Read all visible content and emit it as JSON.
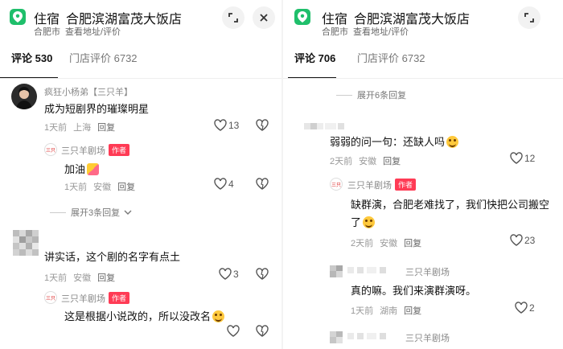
{
  "hotel": {
    "category": "住宿",
    "name": "合肥滨湖富茂大饭店",
    "city": "合肥市",
    "link": "查看地址/评价"
  },
  "left": {
    "tabs": {
      "comments": "评论 530",
      "store_reviews": "门店评价 6732"
    },
    "comments": [
      {
        "user": "疯狂小杨弟【三只羊】",
        "text": "成为短剧界的璀璨明星",
        "time": "1天前",
        "location": "上海",
        "reply": "回复",
        "likes": "13"
      },
      {
        "user": "三只羊剧场",
        "badge": "作者",
        "text": "加油",
        "time": "1天前",
        "location": "安徽",
        "reply": "回复",
        "likes": "4"
      },
      {
        "expand": "展开3条回复"
      },
      {
        "user": "",
        "text": "讲实话，这个剧的名字有点土",
        "time": "1天前",
        "location": "安徽",
        "reply": "回复",
        "likes": "3"
      },
      {
        "user": "三只羊剧场",
        "badge": "作者",
        "text": "这是根据小说改的，所以没改名"
      }
    ]
  },
  "right": {
    "tabs": {
      "comments": "评论 706",
      "store_reviews": "门店评价 6732"
    },
    "comments": [
      {
        "expand": "展开6条回复"
      },
      {
        "user": "",
        "text": "弱弱的问一句：还缺人吗",
        "time": "2天前",
        "location": "安徽",
        "reply": "回复",
        "likes": "12"
      },
      {
        "user": "三只羊剧场",
        "badge": "作者",
        "text_line1": "缺群演，合肥老难找了，我们快把公司搬空",
        "text_line2": "了",
        "time": "2天前",
        "location": "安徽",
        "reply": "回复",
        "likes": "23"
      },
      {
        "user": "三只羊剧场",
        "text": "真的嘛。我们来演群演呀。",
        "time": "1天前",
        "location": "湖南",
        "reply": "回复",
        "likes": "2"
      },
      {
        "user": "三只羊剧场"
      }
    ]
  },
  "colors": {
    "pin_green": "#1fbf6b",
    "author_badge": "#ff3b55"
  },
  "icons": [
    "location-pin-icon",
    "minimize-icon",
    "close-icon",
    "heart-icon",
    "dislike-heart-icon",
    "chevron-down-icon"
  ]
}
